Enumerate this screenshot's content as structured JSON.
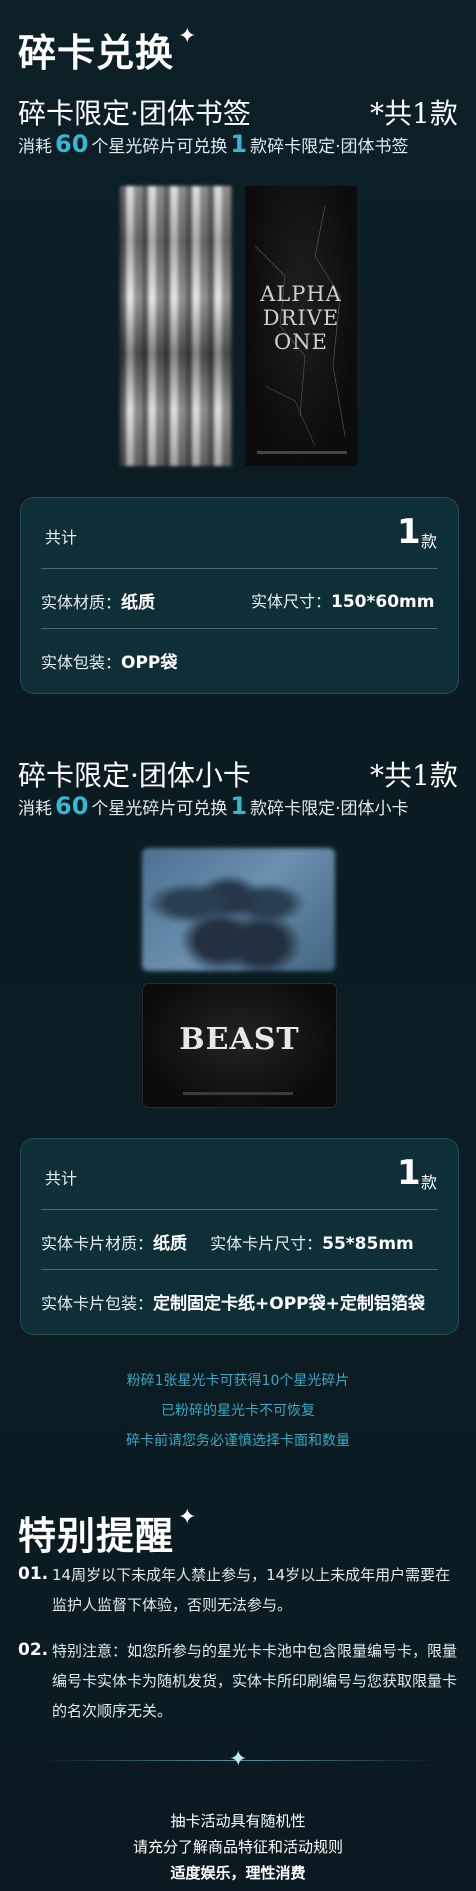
{
  "header": {
    "title": "碎卡兑换",
    "sparkle": "✦"
  },
  "section1": {
    "title": "碎卡限定·团体书签",
    "count": "*共1款",
    "desc_pre": "消耗",
    "desc_num1": "60",
    "desc_mid": "个星光碎片可兑换",
    "desc_num2": "1",
    "desc_post": "款碎卡限定·团体书签",
    "logo_text": [
      "ALPHA",
      "DRIVE",
      "ONE"
    ],
    "panel": {
      "total_label": "共计",
      "total_num": "1",
      "total_unit": "款",
      "material_label": "实体材质：",
      "material_value": "纸质",
      "size_label": "实体尺寸：",
      "size_value": "150*60mm",
      "pack_label": "实体包装：",
      "pack_value": "OPP袋"
    }
  },
  "section2": {
    "title": "碎卡限定·团体小卡",
    "count": "*共1款",
    "desc_pre": "消耗",
    "desc_num1": "60",
    "desc_mid": "个星光碎片可兑换",
    "desc_num2": "1",
    "desc_post": "款碎卡限定·团体小卡",
    "logo_text": "BEAST",
    "panel": {
      "total_label": "共计",
      "total_num": "1",
      "total_unit": "款",
      "material_label": "实体卡片材质：",
      "material_value": "纸质",
      "size_label": "实体卡片尺寸：",
      "size_value": "55*85mm",
      "pack_label": "实体卡片包装：",
      "pack_value": "定制固定卡纸+OPP袋+定制铝箔袋"
    }
  },
  "notes": [
    "粉碎1张星光卡可获得10个星光碎片",
    "已粉碎的星光卡不可恢复",
    "碎卡前请您务必谨慎选择卡面和数量"
  ],
  "reminder": {
    "title": "特别提醒",
    "items": [
      {
        "num": "01.",
        "text": "14周岁以下未成年人禁止参与，14岁以上未成年用户需要在监护人监督下体验，否则无法参与。"
      },
      {
        "num": "02.",
        "text": "特别注意：如您所参与的星光卡卡池中包含限量编号卡，限量编号卡实体卡为随机发货，实体卡所印刷编号与您获取限量卡的名次顺序无关。"
      }
    ]
  },
  "footer": {
    "lines": [
      "抽卡活动具有随机性",
      "请充分了解商品特征和活动规则",
      "适度娱乐，理性消费"
    ]
  }
}
